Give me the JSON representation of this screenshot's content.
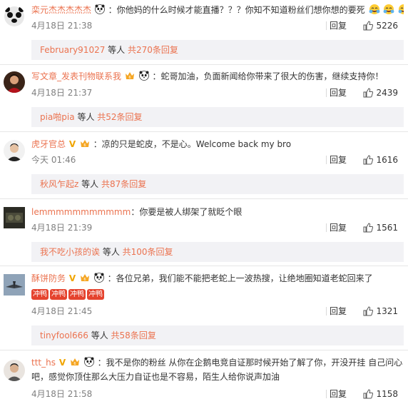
{
  "comments": [
    {
      "username": "栾元杰杰杰杰杰",
      "text": "：你他妈的什么时候才能直播？？？你知不知道粉丝们想你想的要死",
      "time": "4月18日 21:38",
      "reply_label": "回复",
      "likes": "5226",
      "sub_user": "February91027",
      "sub_mid": " 等人 ",
      "sub_count": "共270条回复"
    },
    {
      "username": "写文章_发表刊物联系我",
      "text": "：蛇哥加油，负面新闻给你带来了很大的伤害，继续支持你！",
      "time": "4月18日 21:37",
      "reply_label": "回复",
      "likes": "2439",
      "sub_user": "pia啪pia",
      "sub_mid": " 等人 ",
      "sub_count": "共52条回复"
    },
    {
      "username": "虎牙官总",
      "text": "：凉的只是蛇皮，不是心。Welcome back my bro",
      "time": "今天 01:46",
      "reply_label": "回复",
      "likes": "1616",
      "sub_user": "秋风乍起z",
      "sub_mid": " 等人 ",
      "sub_count": "共87条回复"
    },
    {
      "username": "lemmmmmmmmmmm",
      "text": "：你要是被人绑架了就眨个眼",
      "time": "4月18日 21:39",
      "reply_label": "回复",
      "likes": "1561",
      "sub_user": "我不吃小孩的诶",
      "sub_mid": " 等人 ",
      "sub_count": "共100条回复"
    },
    {
      "username": "酥饼防务",
      "text": "：各位兄弟，我们能不能把老蛇上一波热搜，让绝地圈知道老蛇回来了",
      "fire_label": "冲鸭",
      "time": "4月18日 21:45",
      "reply_label": "回复",
      "likes": "1321",
      "sub_user": "tinyfool666",
      "sub_mid": " 等人 ",
      "sub_count": "共58条回复"
    },
    {
      "username": "ttt_hs",
      "text": "：我不是你的粉丝 从你在企鹅电竞自证那时候开始了解了你，开没开挂 自己问心吧，感觉你顶住那么大压力自证也是不容易，陌生人给你说声加油",
      "time": "4月18日 21:58",
      "reply_label": "回复",
      "likes": "1158"
    }
  ],
  "colors": {
    "username": "#eb7350",
    "sub_bg": "#f2f2f5",
    "meta": "#808080"
  },
  "icons": [
    "panda-icon",
    "vip-crown-icon",
    "verified-v-icon",
    "thumb-up-icon",
    "laughing-emoji-icon",
    "fire-emoji-icon"
  ]
}
